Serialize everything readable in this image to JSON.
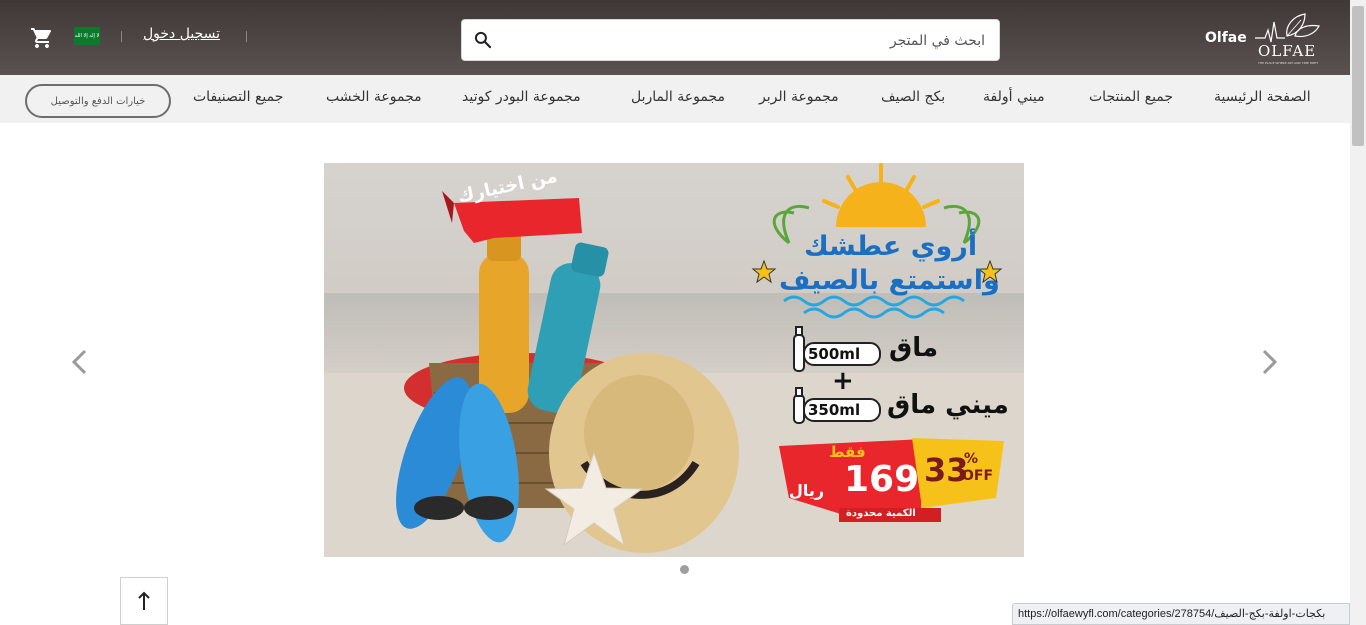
{
  "header": {
    "login_label": "تسجيل دخول",
    "search_placeholder": "ابحث في المتجر",
    "brand_text": "Olfae",
    "logo_word": "OLFAE",
    "logo_tagline": "THE PLACE WHERE ART AND TIME MEET",
    "flag_text": "لا إله إلا الله"
  },
  "nav": {
    "items": [
      "الصفحة الرئيسية",
      "جميع المنتجات",
      "ميني أولفة",
      "بكج الصيف",
      "مجموعة الربر",
      "مجموعة الماربل",
      "مجموعة البودر كوتيد",
      "مجموعة الخشب",
      "جميع التصنيفات"
    ],
    "payment_button": "خيارات الدفع والتوصيل"
  },
  "banner": {
    "ribbon": "من اختيارك",
    "headline_1": "أروي عطشك",
    "headline_2": "واستمتع بالصيف",
    "product_1_name": "ماق",
    "product_1_size": "500ml",
    "plus": "+",
    "product_2_name": "ميني ماق",
    "product_2_size": "350ml",
    "price_prefix": "فقط",
    "price": "169",
    "currency": "ريال",
    "discount": "33",
    "discount_percent": "%",
    "discount_off": "OFF",
    "limited": "الكمية محدودة"
  },
  "status_bar": {
    "url": "https://olfaewyfl.com/categories/278754/بكجات-اولفة-بكج-الصيف"
  },
  "colors": {
    "header_bg": "#4e4644",
    "nav_bg": "#f1f1f1",
    "accent_red": "#e8262b",
    "accent_yellow": "#f6c21a",
    "flag_green": "#0b7a2d"
  }
}
